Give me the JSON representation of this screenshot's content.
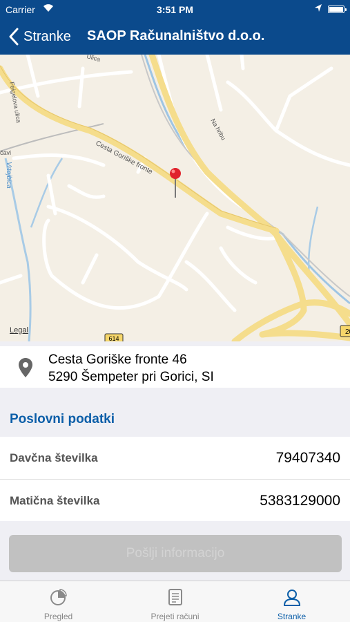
{
  "status_bar": {
    "carrier": "Carrier",
    "time": "3:51 PM"
  },
  "nav": {
    "back_label": "Stranke",
    "title": "SAOP Računalništvo d.o.o."
  },
  "map": {
    "legal": "Legal",
    "street_labels": [
      "Cesta Goriške fronte",
      "Feigelova ulica",
      "Na hribu",
      "Vrtojbica",
      "Ulica",
      "čavi"
    ],
    "road_shields": [
      "614",
      "20"
    ]
  },
  "address": {
    "line1": "Cesta Goriške fronte 46",
    "line2": "5290 Šempeter pri Gorici, SI"
  },
  "section": {
    "title": "Poslovni podatki"
  },
  "rows": [
    {
      "label": "Davčna številka",
      "value": "79407340"
    },
    {
      "label": "Matična številka",
      "value": "5383129000"
    }
  ],
  "send_button": "Pošlji informacijo",
  "tabs": [
    {
      "label": "Pregled",
      "icon": "pie-chart-icon",
      "active": false
    },
    {
      "label": "Prejeti računi",
      "icon": "document-icon",
      "active": false
    },
    {
      "label": "Stranke",
      "icon": "person-icon",
      "active": true
    }
  ],
  "colors": {
    "brand": "#0b4a8c",
    "accent": "#0b5ea8"
  }
}
